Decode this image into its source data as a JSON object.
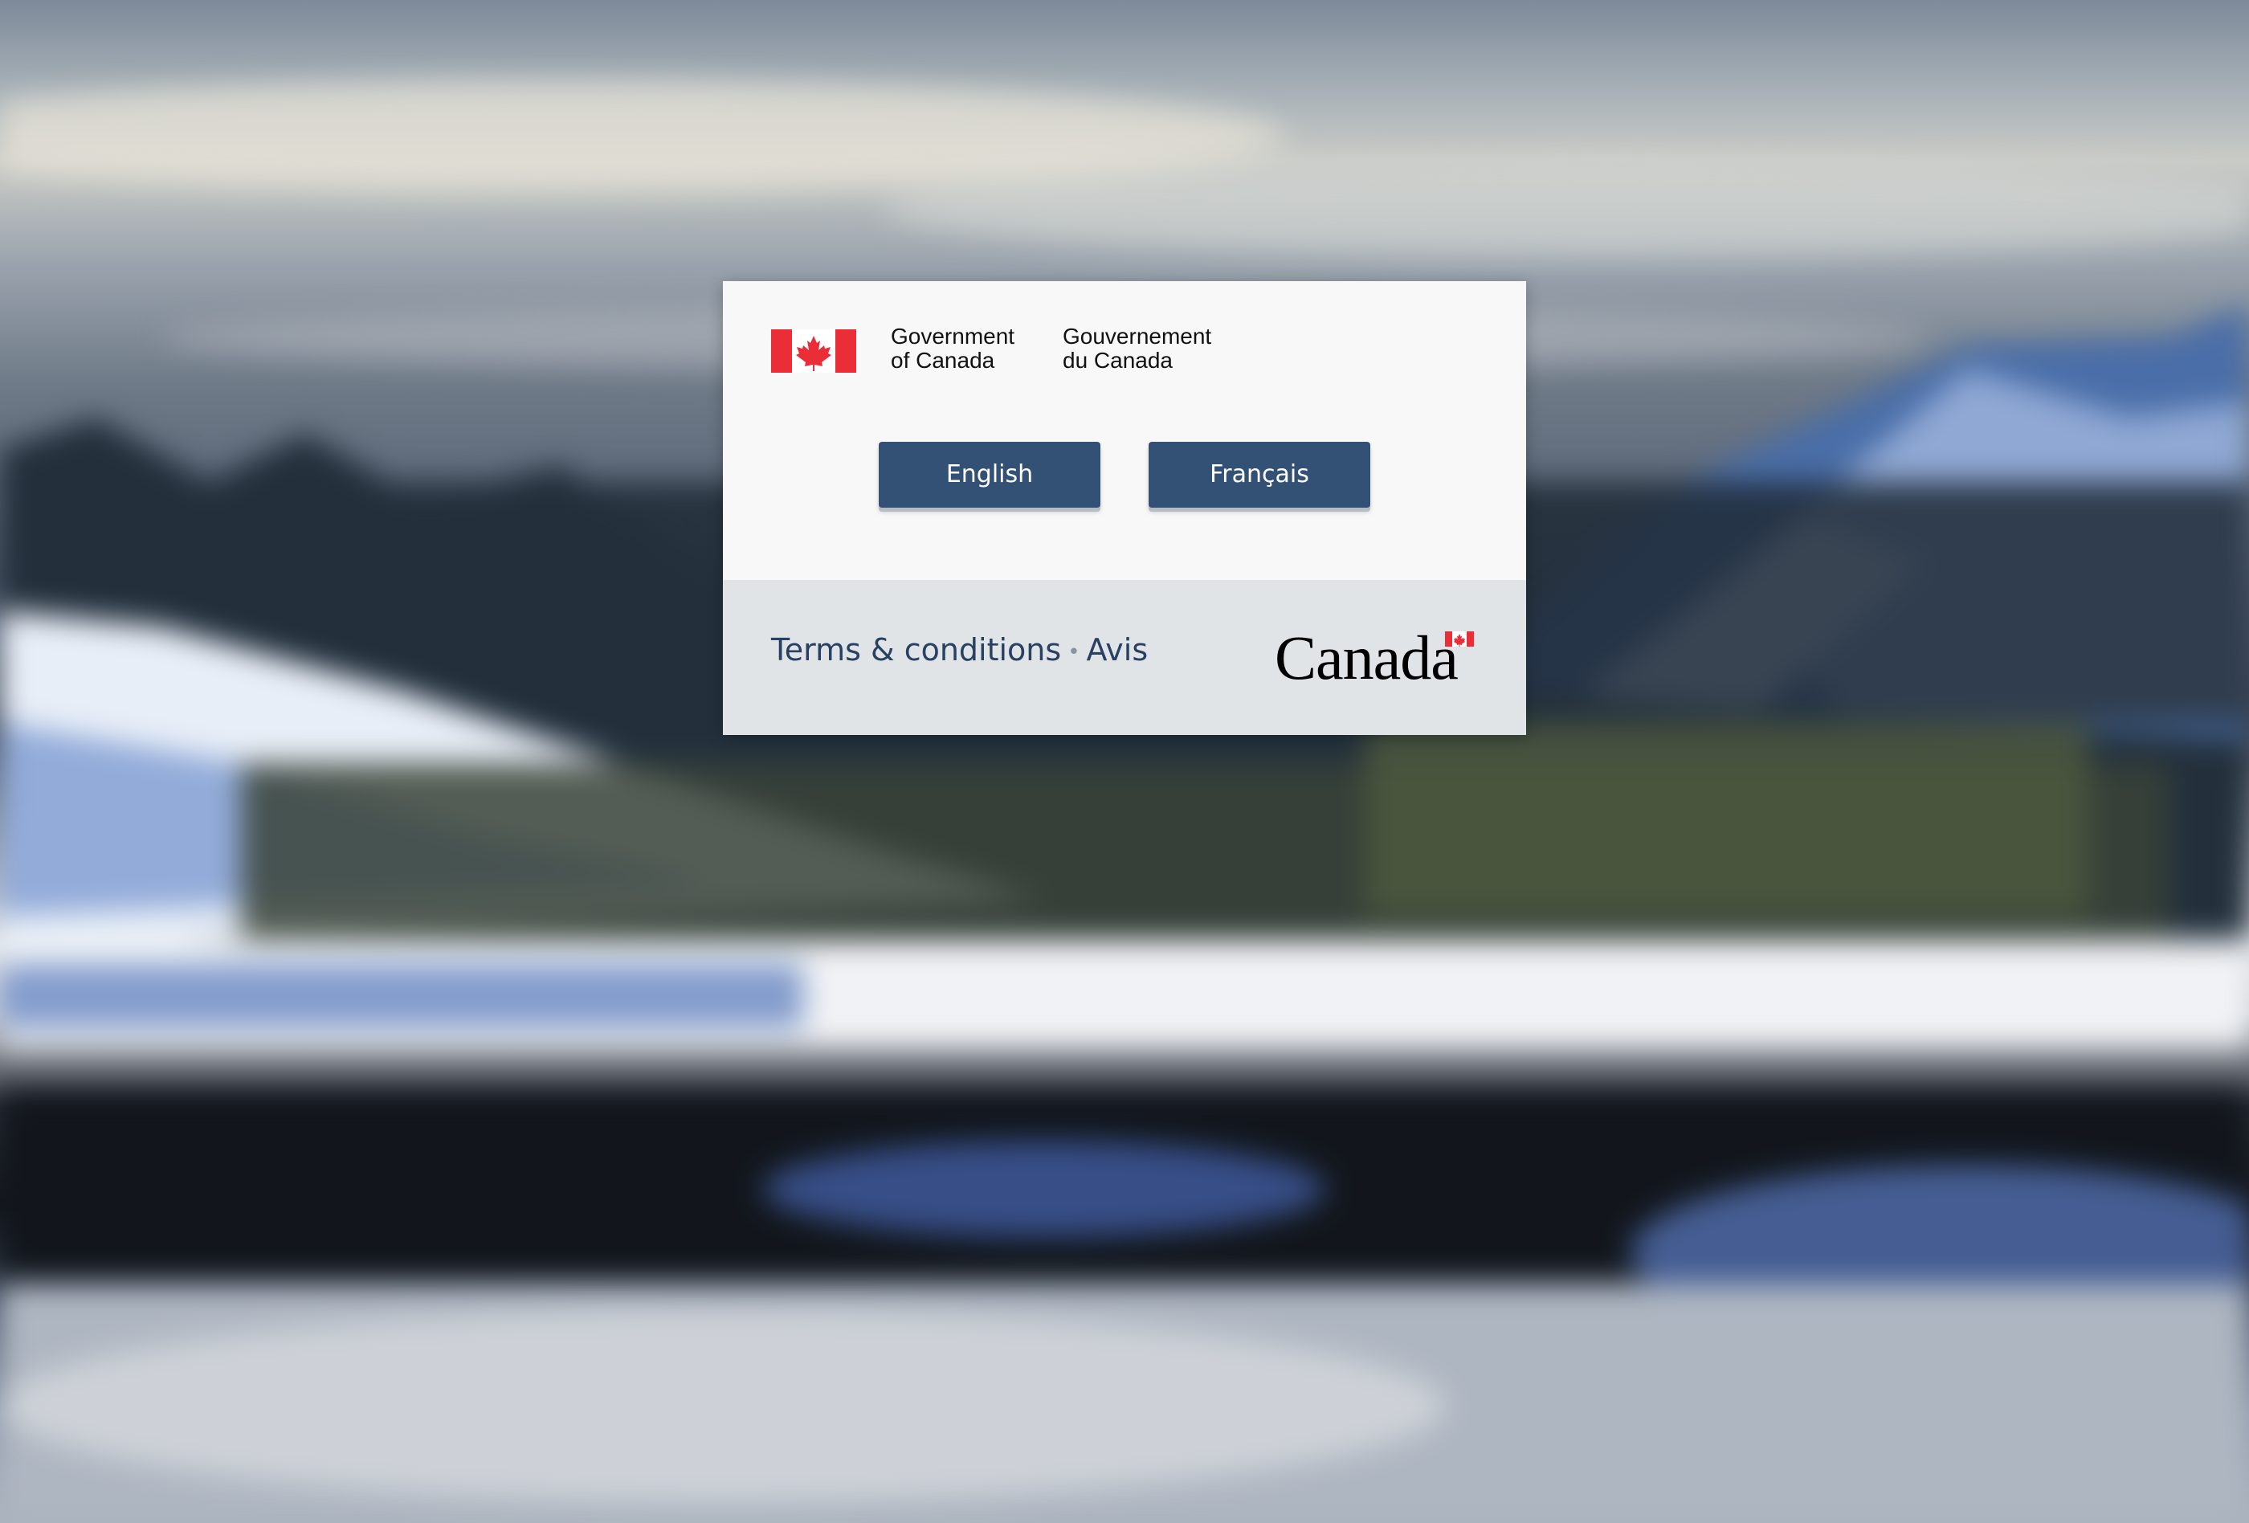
{
  "signature": {
    "english_line1": "Government",
    "english_line2": "of Canada",
    "french_line1": "Gouvernement",
    "french_line2": "du Canada"
  },
  "language_buttons": {
    "english_label": "English",
    "french_label": "Français"
  },
  "footer": {
    "terms_label": "Terms & conditions",
    "separator": "•",
    "avis_label": "Avis"
  },
  "wordmark": {
    "text": "Canada"
  },
  "colors": {
    "button_blue": "#335075",
    "link_blue": "#284162",
    "flag_red": "#eb2d37",
    "card_top": "#f8f8f8",
    "card_bottom": "#e1e4e7"
  },
  "icons": {
    "flag": "canada-flag-icon",
    "wordmark_flag": "canada-wordmark-flag-icon"
  }
}
